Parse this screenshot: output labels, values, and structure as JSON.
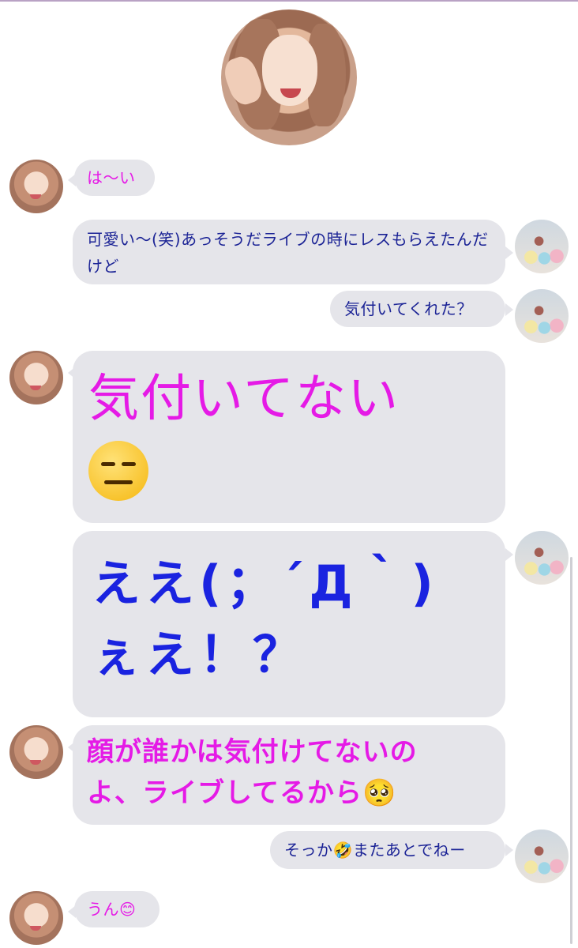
{
  "header": {
    "avatar_icon": "profile-photo-icon"
  },
  "messages": [
    {
      "side": "left",
      "text": "は〜い"
    },
    {
      "side": "right",
      "text": "可愛い〜(笑)あっそうだライブの時にレスもらえたんだけど"
    },
    {
      "side": "right",
      "text": "気付いてくれた？"
    },
    {
      "side": "left",
      "text": "気付いてない",
      "emoji": "😑"
    },
    {
      "side": "right",
      "line1": "ええ(；´Д｀)",
      "line2": "ぇえ！？"
    },
    {
      "side": "left",
      "line1": "顔が誰かは気付けてないの",
      "line2": "よ、ライブしてるから🥺"
    },
    {
      "side": "right",
      "text": "そっか🤣またあとでねー"
    },
    {
      "side": "left",
      "text": "うん😊"
    }
  ],
  "colors": {
    "left_text": "#e51ae6",
    "right_text": "#1c2496",
    "bubble": "#e5e5ea",
    "big_blue": "#1a23e0"
  }
}
